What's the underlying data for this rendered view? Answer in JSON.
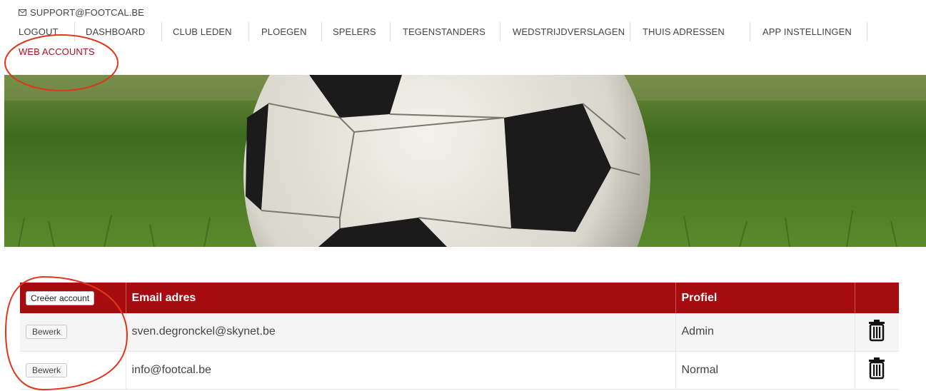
{
  "top": {
    "support_email": "SUPPORT@FOOTCAL.BE"
  },
  "nav": {
    "items": [
      {
        "label": "LOGOUT"
      },
      {
        "label": "DASHBOARD"
      },
      {
        "label": "CLUB LEDEN"
      },
      {
        "label": "PLOEGEN"
      },
      {
        "label": "SPELERS"
      },
      {
        "label": "TEGENSTANDERS"
      },
      {
        "label": "WEDSTRIJDVERSLAGEN"
      },
      {
        "label": "THUIS ADRESSEN"
      },
      {
        "label": "APP INSTELLINGEN"
      }
    ],
    "active_item": {
      "label": "WEB ACCOUNTS"
    }
  },
  "table": {
    "create_button": "Creëer account",
    "headers": {
      "email": "Email adres",
      "profile": "Profiel"
    },
    "rows": [
      {
        "edit_label": "Bewerk",
        "email": "sven.degronckel@skynet.be",
        "profile": "Admin"
      },
      {
        "edit_label": "Bewerk",
        "email": "info@footcal.be",
        "profile": "Normal"
      }
    ]
  },
  "colors": {
    "accent_red": "#a50b0f",
    "active_nav": "#a8121c",
    "annotation": "#e0361c"
  },
  "icons": {
    "mail": "mail-icon",
    "delete": "trash-icon"
  }
}
